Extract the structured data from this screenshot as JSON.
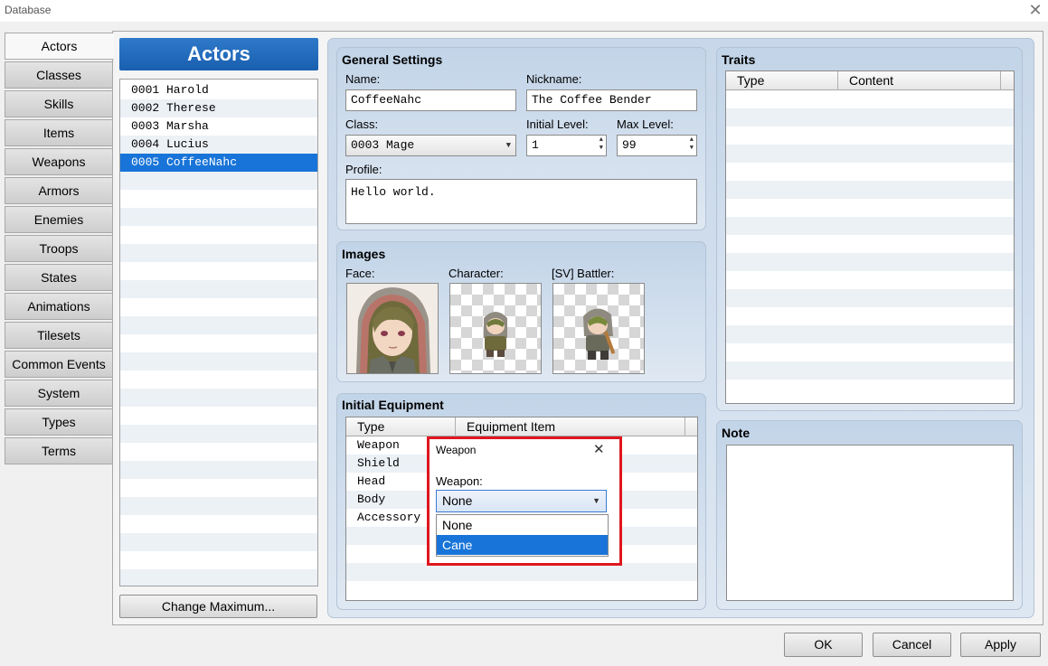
{
  "window": {
    "title": "Database",
    "close_glyph": "✕"
  },
  "categories": [
    {
      "label": "Actors",
      "active": true
    },
    {
      "label": "Classes"
    },
    {
      "label": "Skills"
    },
    {
      "label": "Items"
    },
    {
      "label": "Weapons"
    },
    {
      "label": "Armors"
    },
    {
      "label": "Enemies"
    },
    {
      "label": "Troops"
    },
    {
      "label": "States"
    },
    {
      "label": "Animations"
    },
    {
      "label": "Tilesets"
    },
    {
      "label": "Common Events"
    },
    {
      "label": "System"
    },
    {
      "label": "Types"
    },
    {
      "label": "Terms"
    }
  ],
  "actor_list": {
    "header": "Actors",
    "items": [
      "0001 Harold",
      "0002 Therese",
      "0003 Marsha",
      "0004 Lucius",
      "0005 CoffeeNahc"
    ],
    "selected_index": 4,
    "change_max_label": "Change Maximum..."
  },
  "general": {
    "title": "General Settings",
    "name_label": "Name:",
    "name_value": "CoffeeNahc",
    "nickname_label": "Nickname:",
    "nickname_value": "The Coffee Bender",
    "class_label": "Class:",
    "class_value": "0003 Mage",
    "initial_level_label": "Initial Level:",
    "initial_level_value": "1",
    "max_level_label": "Max Level:",
    "max_level_value": "99",
    "profile_label": "Profile:",
    "profile_value": "Hello world."
  },
  "images": {
    "title": "Images",
    "face_label": "Face:",
    "character_label": "Character:",
    "battler_label": "[SV] Battler:"
  },
  "equipment": {
    "title": "Initial Equipment",
    "col_type": "Type",
    "col_item": "Equipment Item",
    "rows": [
      "Weapon",
      "Shield",
      "Head",
      "Body",
      "Accessory"
    ]
  },
  "traits": {
    "title": "Traits",
    "col_type": "Type",
    "col_content": "Content"
  },
  "note": {
    "title": "Note"
  },
  "popup": {
    "title": "Weapon",
    "close_glyph": "✕",
    "field_label": "Weapon:",
    "selected": "None",
    "options": [
      "None",
      "Cane"
    ],
    "highlighted_index": 1
  },
  "footer": {
    "ok": "OK",
    "cancel": "Cancel",
    "apply": "Apply"
  }
}
